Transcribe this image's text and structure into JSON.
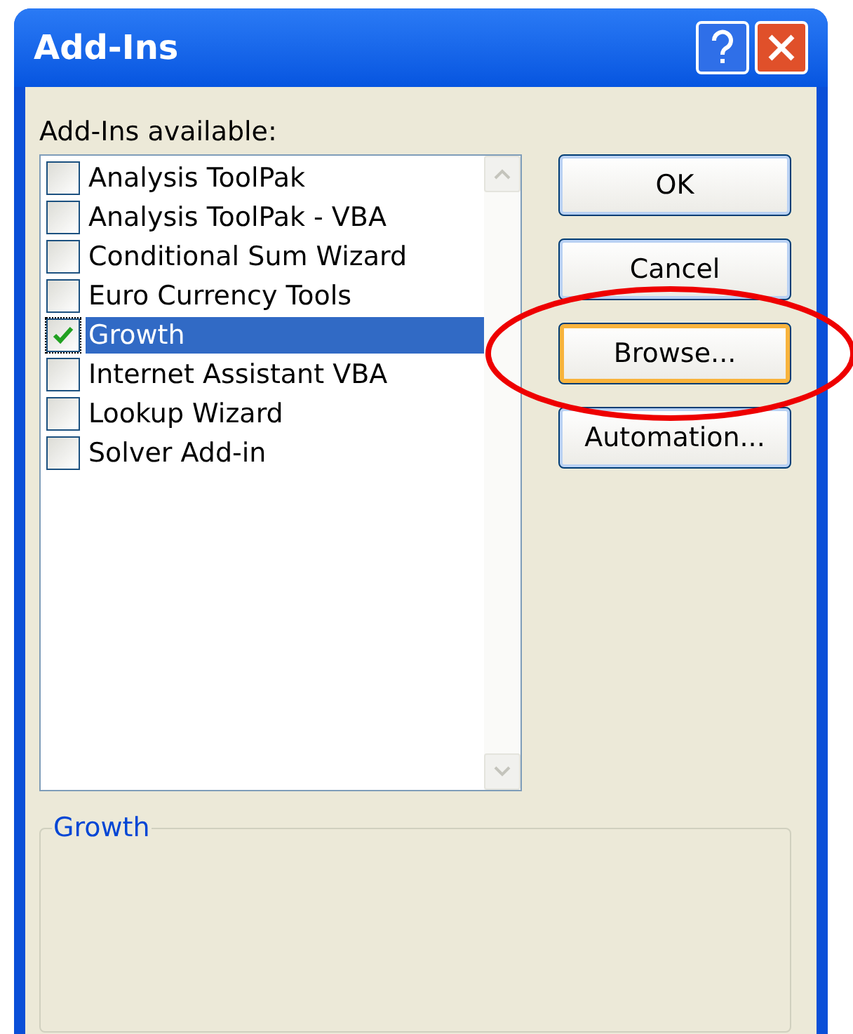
{
  "window": {
    "title": "Add-Ins"
  },
  "list": {
    "label": "Add-Ins available:",
    "items": [
      {
        "label": "Analysis ToolPak",
        "checked": false,
        "selected": false
      },
      {
        "label": "Analysis ToolPak - VBA",
        "checked": false,
        "selected": false
      },
      {
        "label": "Conditional Sum Wizard",
        "checked": false,
        "selected": false
      },
      {
        "label": "Euro Currency Tools",
        "checked": false,
        "selected": false
      },
      {
        "label": "Growth",
        "checked": true,
        "selected": true
      },
      {
        "label": "Internet Assistant VBA",
        "checked": false,
        "selected": false
      },
      {
        "label": "Lookup Wizard",
        "checked": false,
        "selected": false
      },
      {
        "label": "Solver Add-in",
        "checked": false,
        "selected": false
      }
    ]
  },
  "buttons": [
    {
      "label": "OK",
      "highlighted": false
    },
    {
      "label": "Cancel",
      "highlighted": false
    },
    {
      "label": "Browse...",
      "highlighted": true
    },
    {
      "label": "Automation...",
      "highlighted": false
    }
  ],
  "description": {
    "title": "Growth"
  }
}
